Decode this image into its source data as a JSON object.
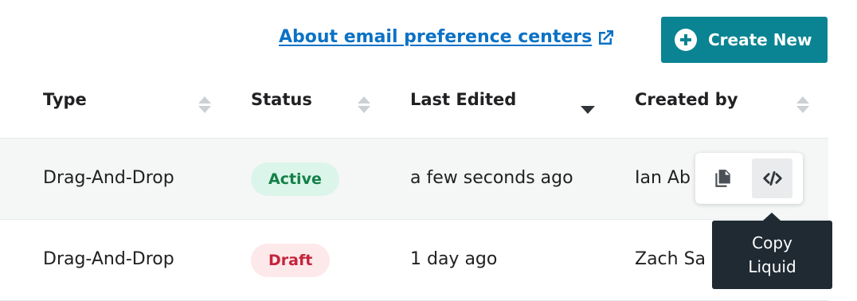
{
  "header": {
    "help_link": "About email preference centers",
    "create_button": "Create New"
  },
  "table": {
    "columns": [
      {
        "label": "Type",
        "sort": "none"
      },
      {
        "label": "Status",
        "sort": "none"
      },
      {
        "label": "Last Edited",
        "sort": "descending"
      },
      {
        "label": "Created by",
        "sort": "none"
      }
    ],
    "rows": [
      {
        "type": "Drag-And-Drop",
        "status": "Active",
        "last_edited": "a few seconds ago",
        "created_by": "Ian Ab"
      },
      {
        "type": "Drag-And-Drop",
        "status": "Draft",
        "last_edited": "1 day ago",
        "created_by": "Zach Sa"
      }
    ]
  },
  "row_actions": {
    "copy_icon": "copy-icon",
    "liquid_icon": "code-icon",
    "tooltip": "Copy Liquid"
  },
  "colors": {
    "accent": "#0a8492",
    "link": "#0b72c5",
    "active_badge_bg": "#dcf5ea",
    "active_badge_text": "#128048",
    "draft_badge_bg": "#fde8ea",
    "draft_badge_text": "#c4253a",
    "tooltip_bg": "#1f2a33"
  }
}
